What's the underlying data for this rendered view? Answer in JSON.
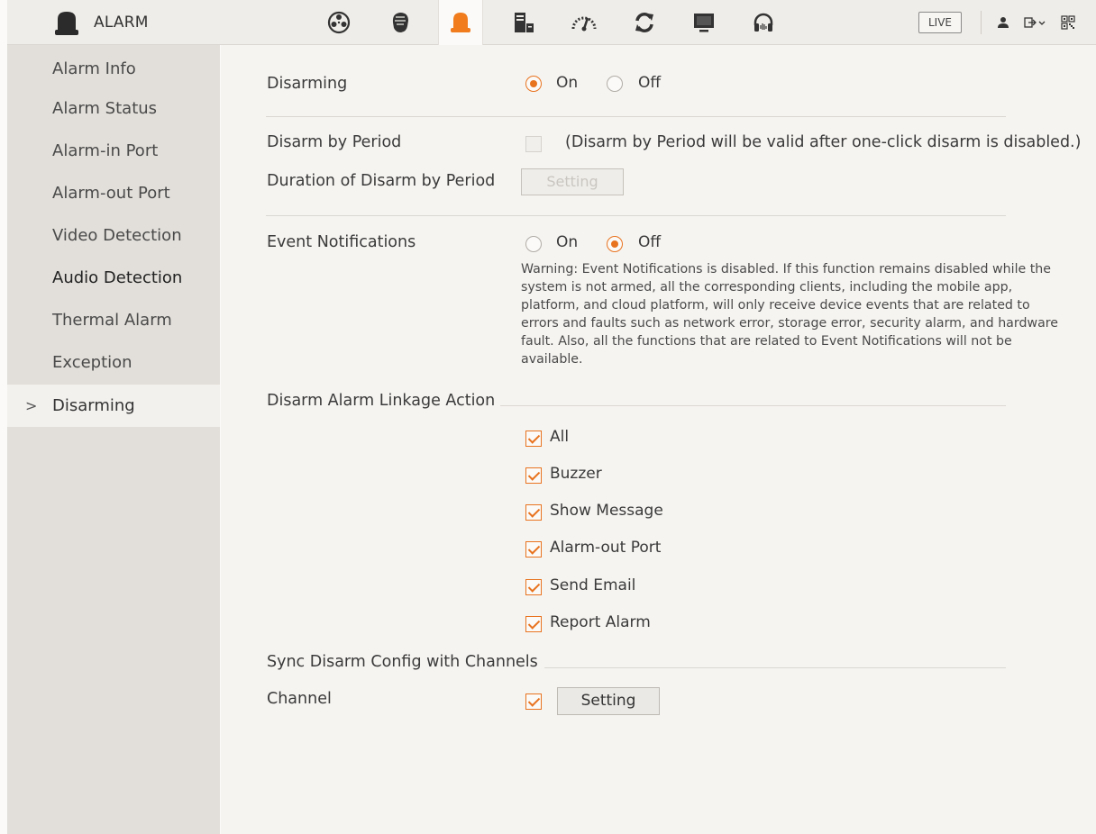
{
  "app": {
    "title": "ALARM"
  },
  "topbar": {
    "nav_icons": [
      "film-reel-icon",
      "face-icon",
      "alarm-bell-icon",
      "storage-icon",
      "gauge-icon",
      "refresh-icon",
      "monitor-icon",
      "headset-icon"
    ],
    "active_nav": "alarm-bell-icon",
    "live_label": "LIVE",
    "right_icons": [
      "user-icon",
      "logout-icon",
      "qr-code-icon"
    ]
  },
  "sidebar": {
    "items": [
      {
        "label": "Alarm Info"
      },
      {
        "label": "Alarm Status"
      },
      {
        "label": "Alarm-in Port"
      },
      {
        "label": "Alarm-out Port"
      },
      {
        "label": "Video Detection"
      },
      {
        "label": "Audio Detection"
      },
      {
        "label": "Thermal Alarm"
      },
      {
        "label": "Exception"
      },
      {
        "label": "Disarming"
      }
    ],
    "selected": "Disarming",
    "chevron": ">"
  },
  "disarming": {
    "label": "Disarming",
    "on_label": "On",
    "off_label": "Off",
    "value": "On"
  },
  "disarm_by_period": {
    "label": "Disarm by Period",
    "checked": false,
    "note": "(Disarm by Period will be valid after one-click disarm is disabled.)"
  },
  "duration": {
    "label": "Duration of Disarm by Period",
    "button_label": "Setting"
  },
  "event_notifications": {
    "label": "Event Notifications",
    "on_label": "On",
    "off_label": "Off",
    "value": "Off",
    "warning": "Warning: Event Notifications is disabled. If this function remains disabled while the system is not armed, all the corresponding clients, including the mobile app, platform, and cloud platform, will only receive device events that are related to errors and faults such as network error, storage error, security alarm, and hardware fault. Also, all the functions that are related to Event Notifications will not be available."
  },
  "linkage": {
    "section_label": "Disarm Alarm Linkage Action",
    "options": [
      {
        "label": "All",
        "checked": true
      },
      {
        "label": "Buzzer",
        "checked": true
      },
      {
        "label": "Show Message",
        "checked": true
      },
      {
        "label": "Alarm-out Port",
        "checked": true
      },
      {
        "label": "Send Email",
        "checked": true
      },
      {
        "label": "Report Alarm",
        "checked": true
      }
    ]
  },
  "sync": {
    "section_label": "Sync Disarm Config with Channels",
    "channel_label": "Channel",
    "channel_checked": true,
    "button_label": "Setting"
  },
  "colors": {
    "accent": "#e8731f",
    "sidebar_bg": "#e2dfda",
    "content_bg": "#f6f4f1"
  }
}
